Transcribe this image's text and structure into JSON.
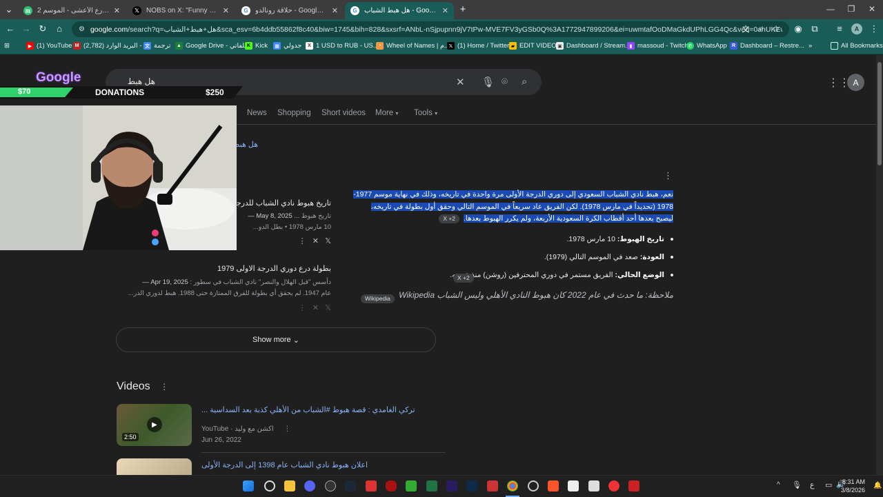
{
  "tabs": [
    {
      "title": "شاهد شارع الأعشى - الموسم 2 / ...",
      "active": false
    },
    {
      "title": "NOBS on X: \"Funny how life w...",
      "active": false
    },
    {
      "title": "حلاقة رونالدو - Google Search",
      "active": false
    },
    {
      "title": "هل هبط الشباب - Google Search",
      "active": true
    }
  ],
  "address": {
    "host": "google.com",
    "path": "/search?q=هل+هبط+الشباب&sca_esv=6b4ddb55862f8c40&biw=1745&bih=828&sxsrf=ANbL-nSjpupnn9jV7tPw-MVE7FV3yGSb0Q%3A1772947899206&ei=uwmtafOoDMaGkdUPhLGG4Qc&ved=0ahUKEwiz8vLNyY-..."
  },
  "bookmarks": [
    "(1) YouTube",
    "(2,782) البريد الوارد - ...",
    "ترجمة",
    "Google Drive - ملفاتي",
    "Kick",
    "جدولي",
    "1 USD to RUB - US...",
    "Wheel of Names | م...",
    "(1) Home / Twitter",
    "EDIT VIDEO",
    "Dashboard / Stream...",
    "massoud - Twitch",
    "WhatsApp",
    "Dashboard – Restre...",
    "All Bookmarks"
  ],
  "search": {
    "query": "هل هبط الشباب"
  },
  "donation": {
    "left": "$70",
    "label": "DONATIONS",
    "right": "$250"
  },
  "nav_tabs": [
    "News",
    "Shopping",
    "Short videos",
    "More",
    "Tools"
  ],
  "partial_link": "هل هبط",
  "overview": {
    "highlighted": "نعم، هبط نادي الشباب السعودي إلى دوري الدرجة الأولى مرة واحدة في تاريخه، وذلك في نهاية موسم 1977-1978 (تحديداً في مارس 1978). لكن الفريق عاد سريعاً في الموسم التالي وحقق أول بطولة في تاريخه، ليصبح بعدها أحد أقطاب الكرة السعودية الأربعة، ولم يكرر الهبوط بعدها.",
    "chip1": "X +2",
    "bullets": [
      {
        "label": "تاريخ الهبوط:",
        "text": " 10 مارس 1978."
      },
      {
        "label": "العودة:",
        "text": " صعد في الموسم التالي (1979)."
      },
      {
        "label": "الوضع الحالي:",
        "text": " الفريق مستمر في دوري المحترفين (روشن) منذ عودته."
      }
    ],
    "chip2": "X +2",
    "note": "ملاحظة: ما حدث في عام 2022 كان هبوط النادي الأهلي وليس الشباب Wikipedia",
    "note_chip": "Wikipedia"
  },
  "sources": [
    {
      "title": "تاريخ هبوط نادي الشباب للدرجة الأ...",
      "date": "May 8, 2025 —",
      "snippet": "تاريخ هبوط ...",
      "snippet2": "10 مارس 1978 • بطل الدو..."
    },
    {
      "title": "بطولة درع دوري الدرجة الاولى 1979",
      "date": "Apr 19, 2025 —",
      "snippet": "دأسس \"قبل الهلال والنصر\" نادي الشباب في سطور :",
      "snippet2": "عام 1947. لم يحقق أي بطولة للفرق الممتازة حتى 1988. هبط لدوري الدر..."
    }
  ],
  "show_more": "Show more",
  "videos_heading": "Videos",
  "videos": [
    {
      "title": "تركي الغامدي : قصة هبوط #الشباب من الأهلي كذبة بعد السداسية ...",
      "source": "YouTube",
      "channel": "اكشن مع وليد",
      "date": "Jun 26, 2022",
      "duration": "2:50"
    },
    {
      "title": "اعلان هبوط نادي الشباب عام 1398 إلى الدرجة الأولى",
      "source": "",
      "channel": "",
      "date": "",
      "duration": ""
    }
  ],
  "clock": {
    "time": "8:31 AM",
    "date": "3/8/2026"
  },
  "tray": {
    "lang": "ع"
  },
  "colors": {
    "accent": "#1a5c57",
    "highlight": "#1a4bb5",
    "link": "#8ab4f8"
  }
}
